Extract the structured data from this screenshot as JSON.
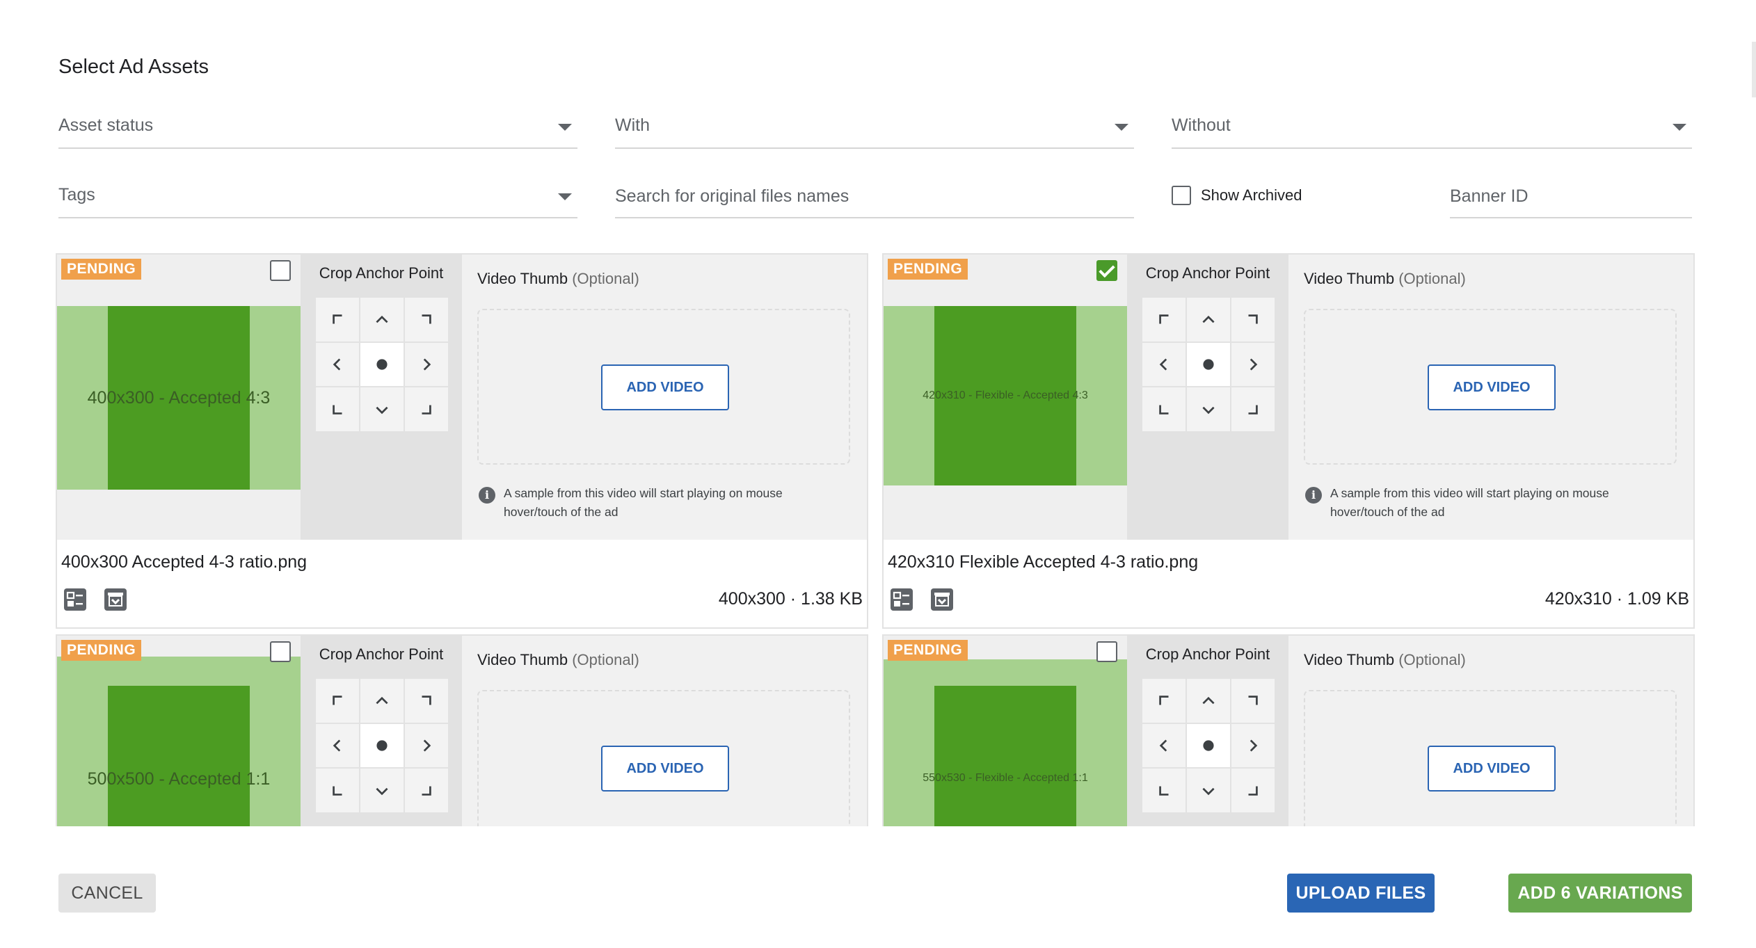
{
  "dialog": {
    "title": "Select Ad Assets"
  },
  "filters": {
    "asset_status": "Asset status",
    "with": "With",
    "without": "Without",
    "tags": "Tags",
    "search_placeholder": "Search for original files names",
    "show_archived": "Show Archived",
    "banner_id": "Banner ID"
  },
  "card_labels": {
    "badge": "PENDING",
    "crop_anchor": "Crop Anchor Point",
    "video_thumb": "Video Thumb",
    "optional": "(Optional)",
    "add_video": "ADD VIDEO",
    "note": "A sample from this video will start playing on mouse hover/touch of the ad"
  },
  "assets": [
    {
      "preview_text": "400x300 - Accepted 4:3",
      "selected": false,
      "file_name": "400x300 Accepted 4-3 ratio.png",
      "dims": "400x300 · 1.38 KB"
    },
    {
      "preview_text": "420x310 - Flexible - Accepted 4:3",
      "selected": true,
      "file_name": "420x310 Flexible Accepted 4-3 ratio.png",
      "dims": "420x310 · 1.09 KB"
    },
    {
      "preview_text": "500x500 - Accepted 1:1",
      "selected": false
    },
    {
      "preview_text": "550x530 - Flexible - Accepted 1:1",
      "selected": false
    }
  ],
  "icons": {
    "details": "details-icon",
    "archive": "archive-icon",
    "info": "info-icon"
  },
  "colors": {
    "badge": "#f0a04b",
    "preview_light": "#a6d18e",
    "preview_dark": "#4c9c22",
    "primary": "#2a66b5",
    "success": "#68a84f"
  },
  "footer": {
    "cancel": "CANCEL",
    "upload": "UPLOAD FILES",
    "add_variations": "ADD 6 VARIATIONS"
  }
}
